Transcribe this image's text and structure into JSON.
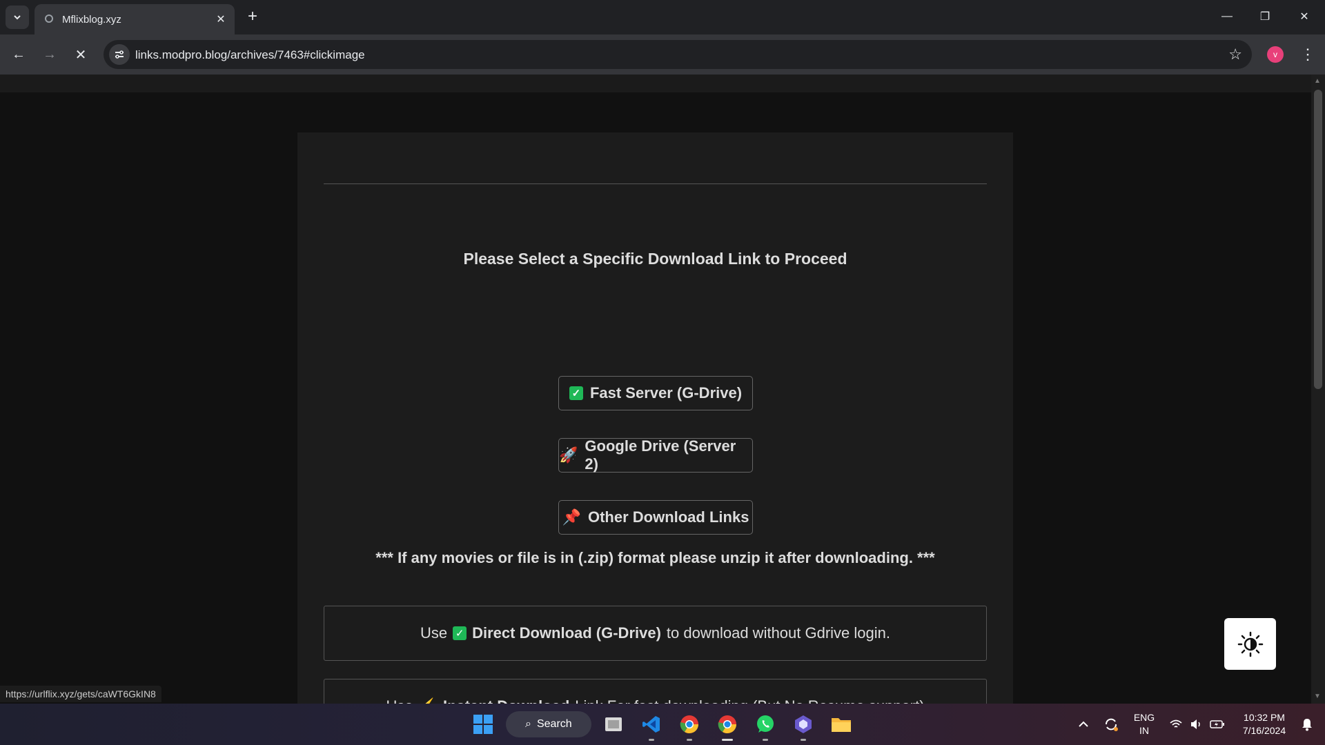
{
  "browser": {
    "tab_title": "Mflixblog.xyz",
    "url": "links.modpro.blog/archives/7463#clickimage",
    "profile_initial": "v",
    "status_url": "https://urlflix.xyz/gets/caWT6GkIN8"
  },
  "page": {
    "select_heading": "Please Select a Specific Download Link to Proceed",
    "buttons": [
      {
        "label": "Fast Server (G-Drive)",
        "icon": "check-icon"
      },
      {
        "label": "Google Drive (Server 2)",
        "icon": "rocket-icon"
      },
      {
        "label": "Other Download Links",
        "icon": "pushpin-icon"
      }
    ],
    "zip_note": "*** If any movies or file is in (.zip) format please unzip it after downloading. ***",
    "info1": {
      "prefix": "Use",
      "bold": "Direct Download (G-Drive)",
      "suffix": "to download without Gdrive login."
    },
    "info2": {
      "prefix": "Use",
      "bold": "Instant Download",
      "suffix": "Link For fast downloading (But No Resume support)"
    }
  },
  "taskbar": {
    "search_label": "Search",
    "lang_top": "ENG",
    "lang_bottom": "IN",
    "time": "10:32 PM",
    "date": "7/16/2024"
  },
  "colors": {
    "accent_check": "#1fb857",
    "profile": "#e8407a"
  }
}
